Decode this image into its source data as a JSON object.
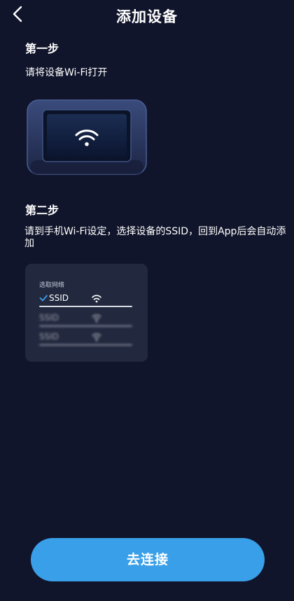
{
  "header": {
    "title": "添加设备"
  },
  "step1": {
    "title": "第一步",
    "description": "请将设备Wi-Fi打开"
  },
  "step2": {
    "title": "第二步",
    "description": "请到手机Wi-Fi设定，选择设备的SSID，回到App后会自动添加"
  },
  "network_card": {
    "label": "选取网络",
    "networks": [
      {
        "name": "SSID",
        "selected": true
      },
      {
        "name": "SSID",
        "selected": false
      },
      {
        "name": "SSID",
        "selected": false
      }
    ]
  },
  "connect_button": {
    "label": "去连接"
  },
  "colors": {
    "background": "#11152b",
    "accent": "#3a9fe9",
    "card": "#22283e"
  }
}
